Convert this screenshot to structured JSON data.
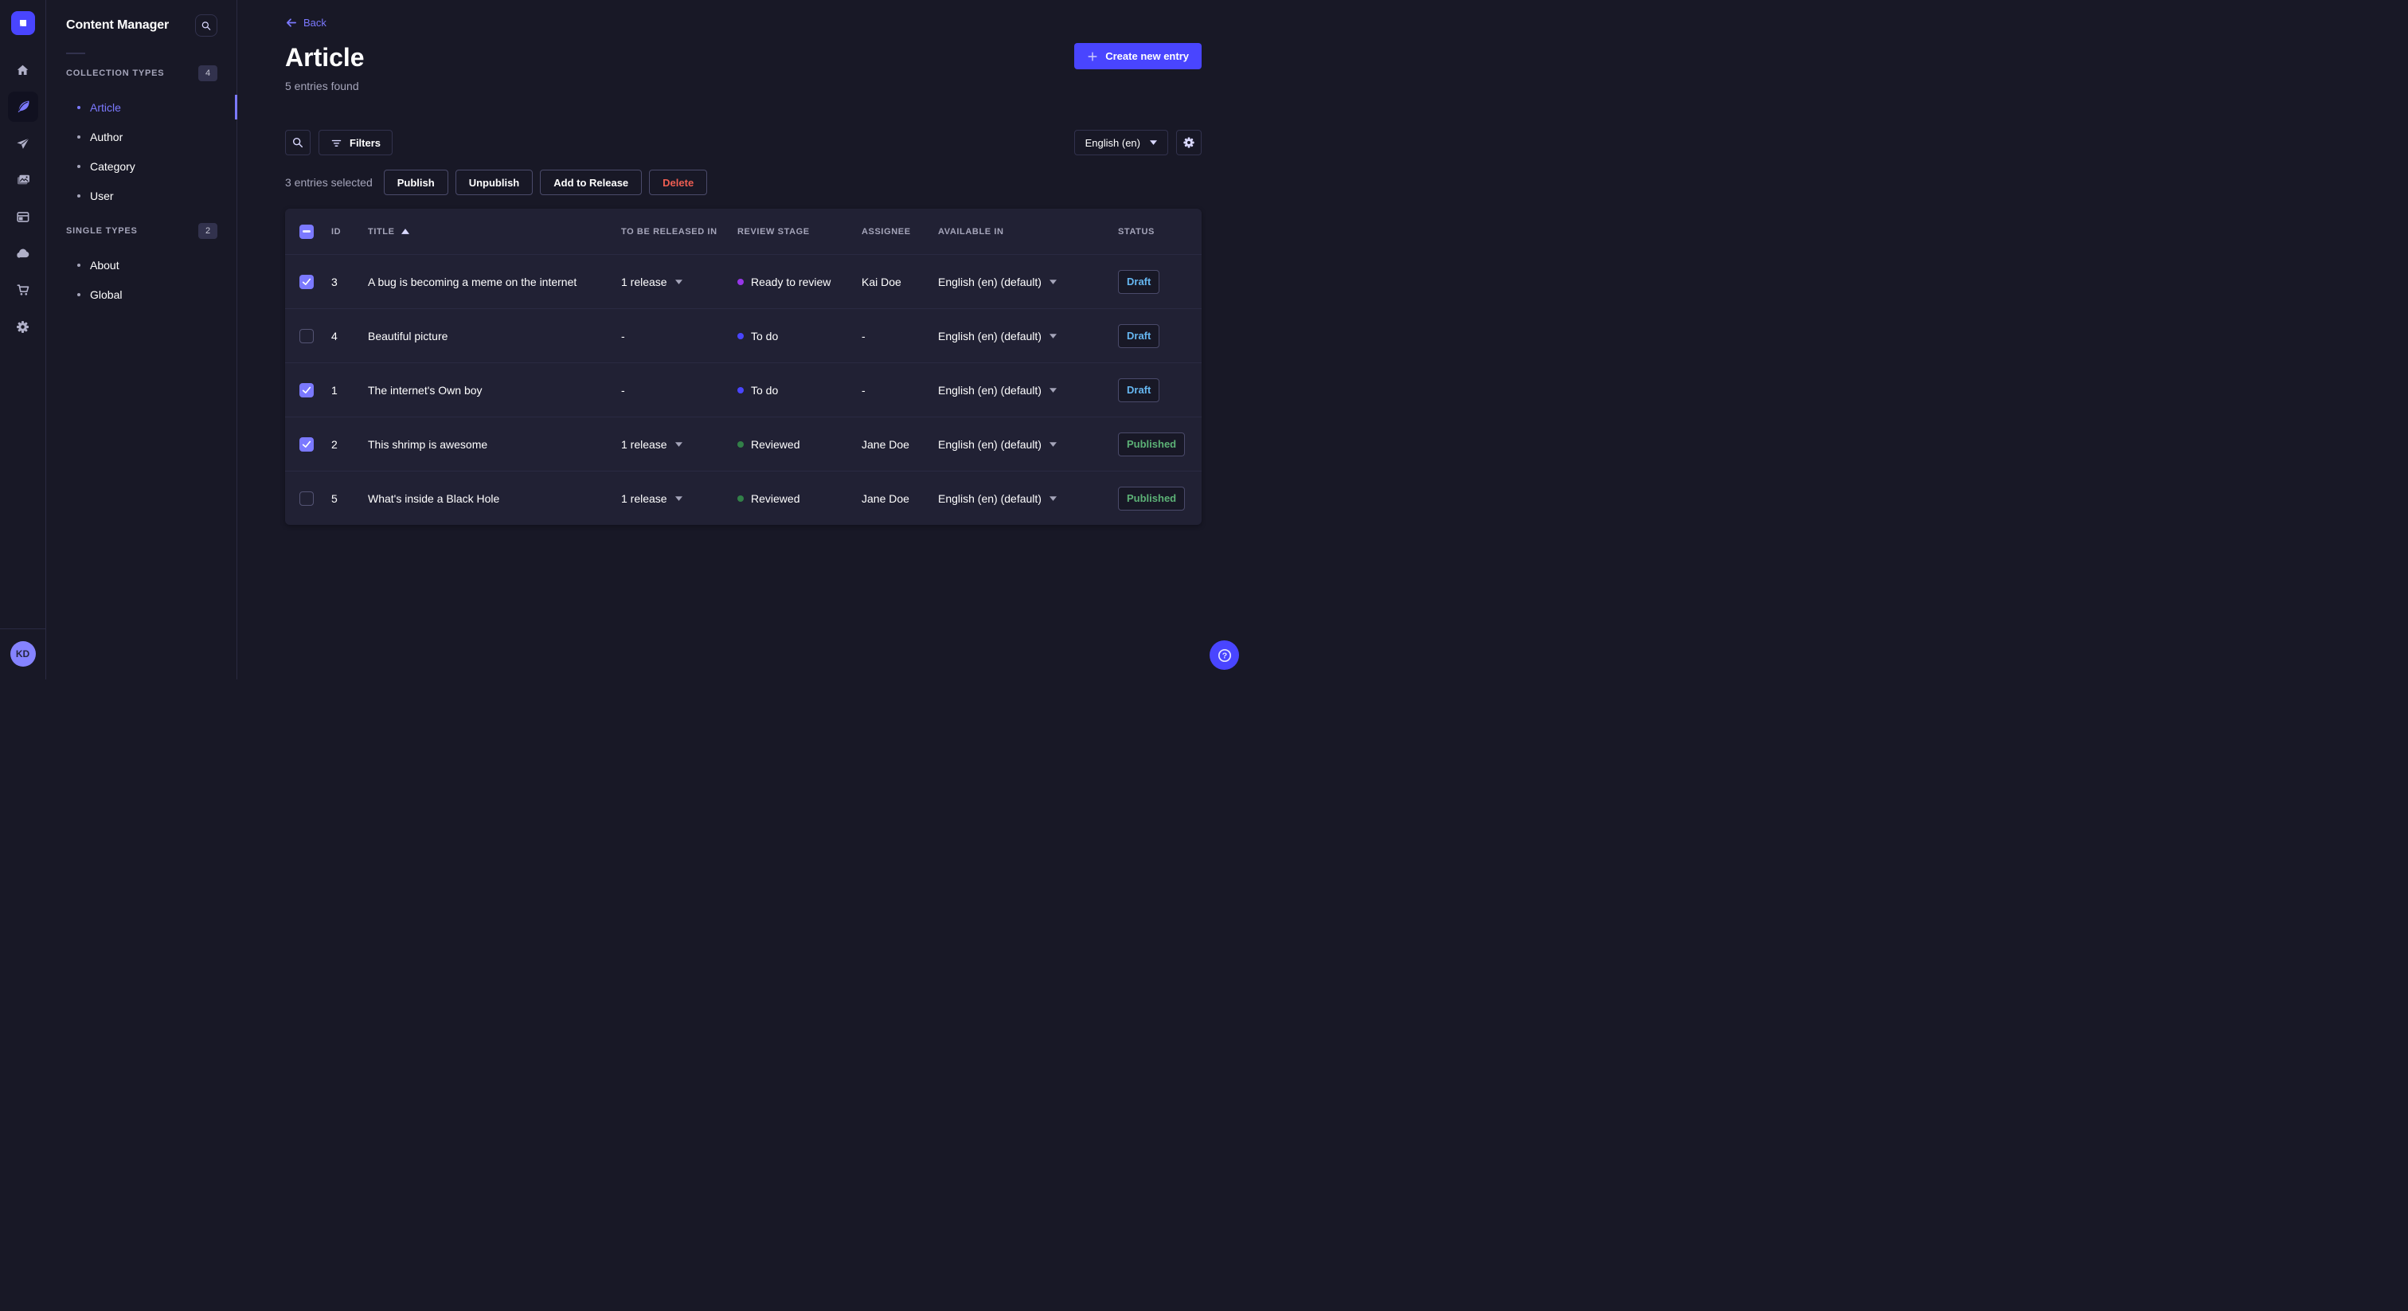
{
  "rail": {
    "icons": [
      "home",
      "content-manager",
      "releases",
      "media-library",
      "content-type-builder",
      "cloud",
      "marketplace",
      "settings"
    ],
    "active_icon": "content-manager",
    "avatar_initials": "KD"
  },
  "sidebar": {
    "title": "Content Manager",
    "sections": [
      {
        "label": "COLLECTION TYPES",
        "badge": "4",
        "items": [
          {
            "label": "Article",
            "active": true
          },
          {
            "label": "Author",
            "active": false
          },
          {
            "label": "Category",
            "active": false
          },
          {
            "label": "User",
            "active": false
          }
        ]
      },
      {
        "label": "SINGLE TYPES",
        "badge": "2",
        "items": [
          {
            "label": "About",
            "active": false
          },
          {
            "label": "Global",
            "active": false
          }
        ]
      }
    ]
  },
  "header": {
    "back_label": "Back",
    "title": "Article",
    "subtitle": "5 entries found",
    "create_button": "Create new entry"
  },
  "toolbar": {
    "filters_label": "Filters",
    "locale_value": "English (en)"
  },
  "selection": {
    "text": "3 entries selected",
    "actions": [
      {
        "label": "Publish",
        "danger": false
      },
      {
        "label": "Unpublish",
        "danger": false
      },
      {
        "label": "Add to Release",
        "danger": false
      },
      {
        "label": "Delete",
        "danger": true
      }
    ]
  },
  "table": {
    "columns": [
      "ID",
      "TITLE",
      "TO BE RELEASED IN",
      "REVIEW STAGE",
      "ASSIGNEE",
      "AVAILABLE IN",
      "STATUS"
    ],
    "sorted_column": "TITLE",
    "header_checkbox": "indeterminate",
    "rows": [
      {
        "checked": true,
        "id": "3",
        "title": "A bug is becoming a meme on the internet",
        "release": "1 release",
        "stage": {
          "label": "Ready to review",
          "color": "#9736e8"
        },
        "assignee": "Kai Doe",
        "locale": "English (en) (default)",
        "status": {
          "label": "Draft",
          "kind": "draft"
        }
      },
      {
        "checked": false,
        "id": "4",
        "title": "Beautiful picture",
        "release": "-",
        "stage": {
          "label": "To do",
          "color": "#4945ff"
        },
        "assignee": "-",
        "locale": "English (en) (default)",
        "status": {
          "label": "Draft",
          "kind": "draft"
        }
      },
      {
        "checked": true,
        "id": "1",
        "title": "The internet's Own boy",
        "release": "-",
        "stage": {
          "label": "To do",
          "color": "#4945ff"
        },
        "assignee": "-",
        "locale": "English (en) (default)",
        "status": {
          "label": "Draft",
          "kind": "draft"
        }
      },
      {
        "checked": true,
        "id": "2",
        "title": "This shrimp is awesome",
        "release": "1 release",
        "stage": {
          "label": "Reviewed",
          "color": "#328048"
        },
        "assignee": "Jane Doe",
        "locale": "English (en) (default)",
        "status": {
          "label": "Published",
          "kind": "published"
        }
      },
      {
        "checked": false,
        "id": "5",
        "title": "What's inside a Black Hole",
        "release": "1 release",
        "stage": {
          "label": "Reviewed",
          "color": "#328048"
        },
        "assignee": "Jane Doe",
        "locale": "English (en) (default)",
        "status": {
          "label": "Published",
          "kind": "published"
        }
      }
    ]
  },
  "colors": {
    "background": "#181826",
    "surface": "#212134",
    "border": "#32324d",
    "primary": "#4945ff",
    "primary_light": "#7b79ff",
    "draft": "#66b7f1",
    "published": "#5cb176",
    "danger": "#ee5e52"
  }
}
